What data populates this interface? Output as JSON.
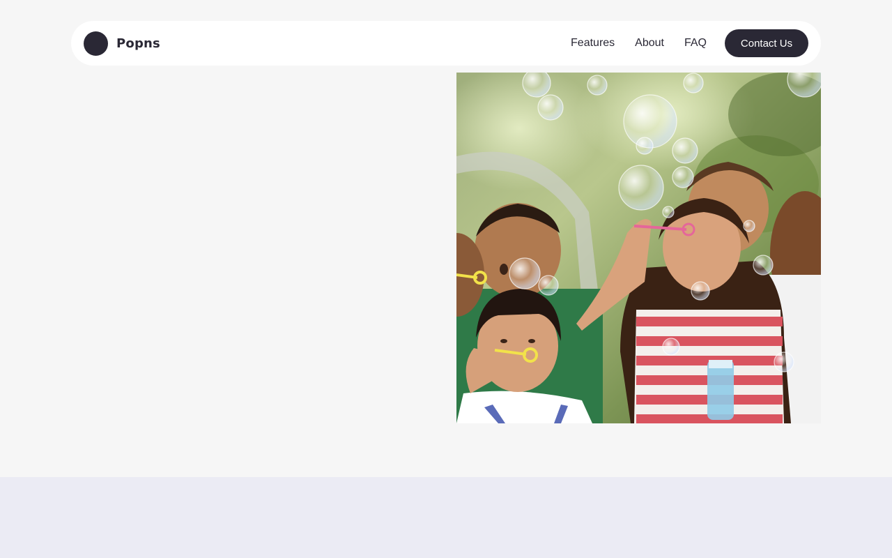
{
  "header": {
    "brand_name": "Popns",
    "nav": {
      "features": "Features",
      "about": "About",
      "faq": "FAQ"
    },
    "contact_label": "Contact Us"
  },
  "hero": {
    "image_icon": "photo-children-blowing-bubbles"
  },
  "colors": {
    "accent": "#2a2835",
    "page_bg": "#f6f6f6",
    "band_bg": "#ebebf4"
  }
}
